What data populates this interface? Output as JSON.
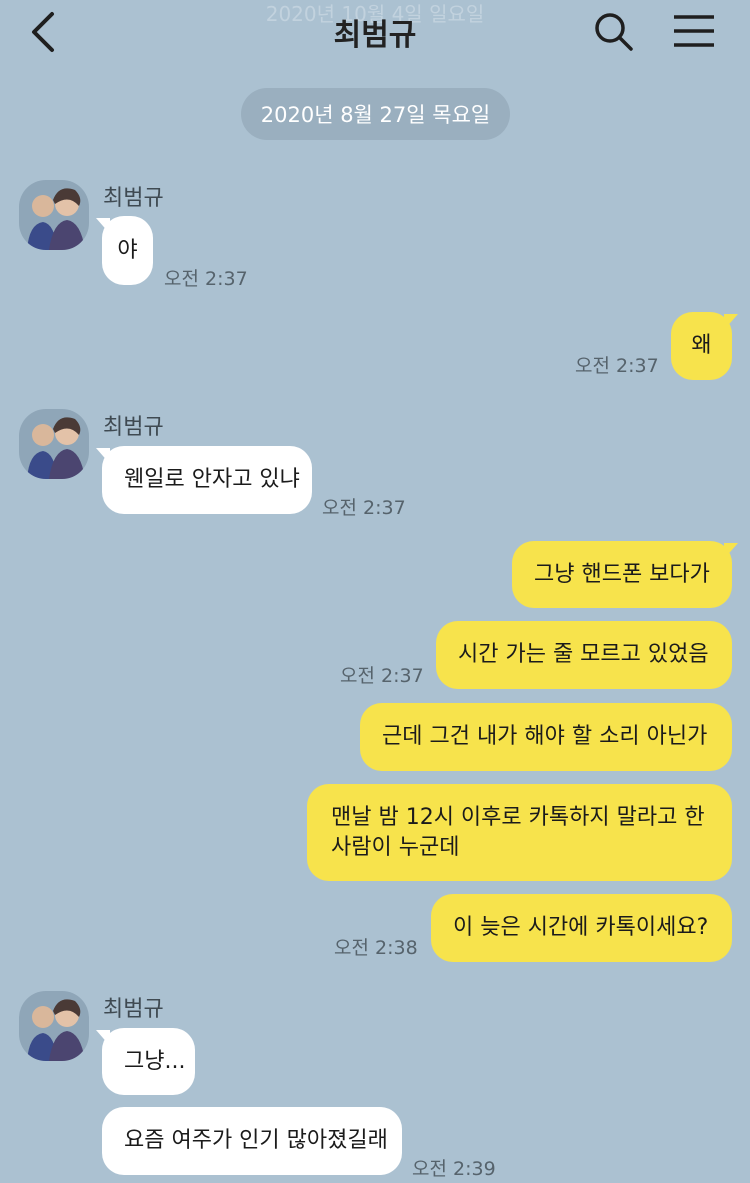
{
  "header": {
    "ghost_date": "2020년 10월 4일 일요일",
    "title": "최범규",
    "back_icon": "chevron-left-icon",
    "search_icon": "search-icon",
    "menu_icon": "hamburger-menu-icon"
  },
  "date_divider": "2020년 8월 27일 목요일",
  "colors": {
    "background": "#abc1d1",
    "outgoing_bubble": "#f7e34c",
    "incoming_bubble": "#ffffff"
  },
  "messages": [
    {
      "sender": "최범규",
      "text": "야",
      "time": "오전 2:37"
    },
    {
      "text": "왜",
      "time": "오전 2:37"
    },
    {
      "sender": "최범규",
      "text": "웬일로 안자고 있냐",
      "time": "오전 2:37"
    },
    {
      "text": "그냥 핸드폰 보다가"
    },
    {
      "text": "시간 가는 줄 모르고 있었음",
      "time": "오전 2:37"
    },
    {
      "text": "근데 그건 내가 해야 할 소리 아닌가"
    },
    {
      "text": "맨날 밤 12시 이후로 카톡하지 말라고 한 사람이 누군데"
    },
    {
      "text": "이 늦은 시간에 카톡이세요?",
      "time": "오전 2:38"
    },
    {
      "sender": "최범규",
      "text": "그냥..."
    },
    {
      "text": "요즘 여주가 인기 많아졌길래",
      "time": "오전 2:39"
    }
  ]
}
